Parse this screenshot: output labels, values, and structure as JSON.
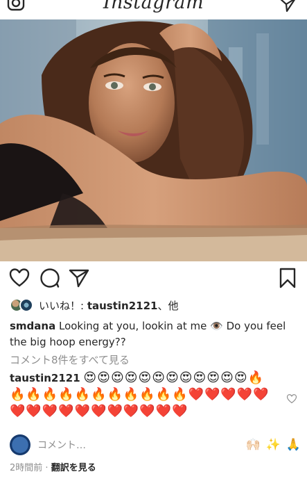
{
  "app": {
    "title": "Instagram"
  },
  "post": {
    "likes": {
      "prefix": "いいね！: ",
      "user": "taustin2121",
      "suffix": "、他"
    },
    "caption": {
      "user": "smdana",
      "text": " Looking at you, lookin at me 👁️  Do you feel the big hoop energy??"
    },
    "view_all_comments": "コメント8件をすべて見る",
    "comment": {
      "user": "taustin2121",
      "emojis": "😍😍😍😍😍😍😍😍😍😍😍😍🔥🔥🔥🔥🔥🔥🔥🔥🔥🔥🔥🔥❤️❤️❤️❤️❤️❤️❤️❤️❤️❤️❤️❤️❤️❤️❤️❤️"
    },
    "add_comment_placeholder": "コメント…",
    "quick_emojis": [
      "🙌🏻",
      "✨",
      "🙏"
    ],
    "time_ago": "2時間前",
    "separator": " · ",
    "translate": "翻訳を見る"
  },
  "colors": {
    "text": "#262626",
    "muted": "#8e8e8e",
    "bg": "#ffffff"
  },
  "icons": [
    "camera-icon",
    "send-icon",
    "heart-icon",
    "comment-icon",
    "share-icon",
    "bookmark-icon"
  ]
}
